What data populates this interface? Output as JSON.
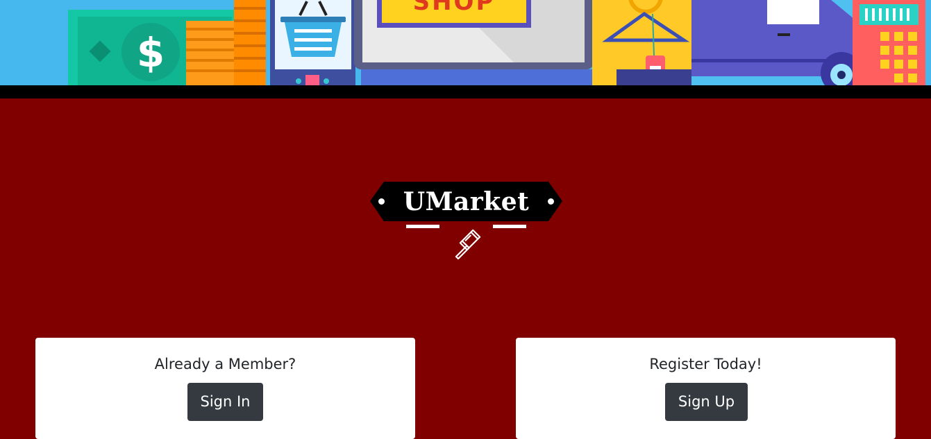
{
  "banner": {
    "shop_sign": "SHOP",
    "currency_symbol": "$"
  },
  "logo": {
    "title": "UMarket"
  },
  "cards": {
    "member": {
      "heading": "Already a Member?",
      "button_label": "Sign In"
    },
    "register": {
      "heading": "Register Today!",
      "button_label": "Sign Up"
    }
  },
  "colors": {
    "page_background": "#800000",
    "button_background": "#343a40",
    "card_background": "#ffffff",
    "logo_plate": "#000000"
  }
}
